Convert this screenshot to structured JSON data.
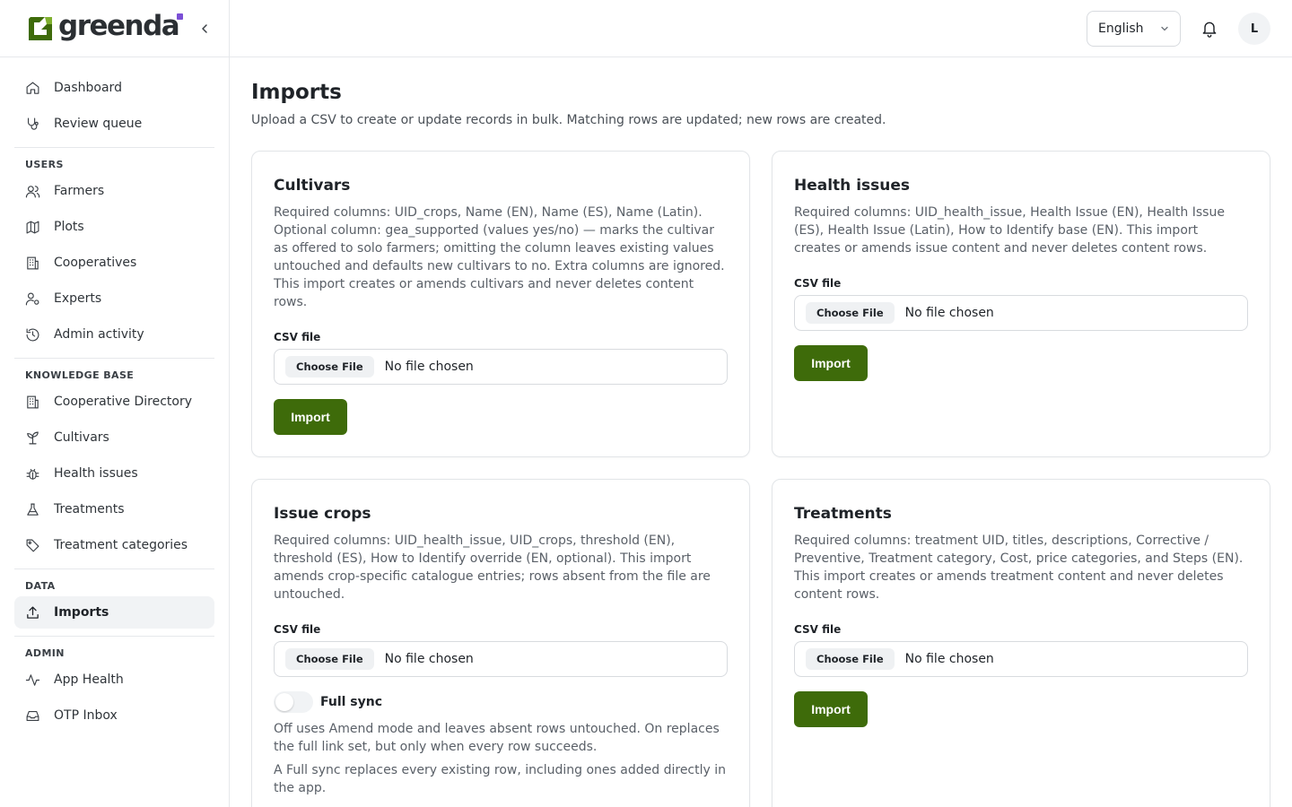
{
  "brand": {
    "name": "greenda",
    "accent": "#7b4fd6",
    "logo_green": "#3e6b0a"
  },
  "topbar": {
    "language": "English",
    "avatar_initial": "L"
  },
  "sidebar": {
    "top_items": [
      {
        "label": "Dashboard",
        "icon": "home-icon"
      },
      {
        "label": "Review queue",
        "icon": "stethoscope-icon"
      }
    ],
    "sections": [
      {
        "title": "USERS",
        "items": [
          {
            "label": "Farmers",
            "icon": "users-icon"
          },
          {
            "label": "Plots",
            "icon": "map-icon"
          },
          {
            "label": "Cooperatives",
            "icon": "building-icon"
          },
          {
            "label": "Experts",
            "icon": "user-cog-icon"
          },
          {
            "label": "Admin activity",
            "icon": "history-icon"
          }
        ]
      },
      {
        "title": "KNOWLEDGE BASE",
        "items": [
          {
            "label": "Cooperative Directory",
            "icon": "building-icon"
          },
          {
            "label": "Cultivars",
            "icon": "sprout-icon"
          },
          {
            "label": "Health issues",
            "icon": "bug-icon"
          },
          {
            "label": "Treatments",
            "icon": "flask-icon"
          },
          {
            "label": "Treatment categories",
            "icon": "tag-icon"
          }
        ]
      },
      {
        "title": "DATA",
        "items": [
          {
            "label": "Imports",
            "icon": "upload-icon",
            "active": true
          }
        ]
      },
      {
        "title": "ADMIN",
        "items": [
          {
            "label": "App Health",
            "icon": "activity-icon"
          },
          {
            "label": "OTP Inbox",
            "icon": "inbox-icon"
          }
        ]
      }
    ]
  },
  "page": {
    "title": "Imports",
    "subtitle": "Upload a CSV to create or update records in bulk. Matching rows are updated; new rows are created."
  },
  "common": {
    "csv_label": "CSV file",
    "choose_file": "Choose File",
    "no_file": "No file chosen",
    "import_label": "Import"
  },
  "cards": {
    "cultivars": {
      "title": "Cultivars",
      "description": "Required columns: UID_crops, Name (EN), Name (ES), Name (Latin). Optional column: gea_supported (values yes/no) — marks the cultivar as offered to solo farmers; omitting the column leaves existing values untouched and defaults new cultivars to no. Extra columns are ignored. This import creates or amends cultivars and never deletes content rows."
    },
    "health_issues": {
      "title": "Health issues",
      "description": "Required columns: UID_health_issue, Health Issue (EN), Health Issue (ES), Health Issue (Latin), How to Identify base (EN). This import creates or amends issue content and never deletes content rows."
    },
    "issue_crops": {
      "title": "Issue crops",
      "description": "Required columns: UID_health_issue, UID_crops, threshold (EN), threshold (ES), How to Identify override (EN, optional). This import amends crop-specific catalogue entries; rows absent from the file are untouched.",
      "toggle_label": "Full sync",
      "toggle_on": false,
      "note1": "Off uses Amend mode and leaves absent rows untouched. On replaces the full link set, but only when every row succeeds.",
      "note2": "A Full sync replaces every existing row, including ones added directly in the app."
    },
    "treatments": {
      "title": "Treatments",
      "description": "Required columns: treatment UID, titles, descriptions, Corrective / Preventive, Treatment category, Cost, price categories, and Steps (EN). This import creates or amends treatment content and never deletes content rows."
    }
  }
}
